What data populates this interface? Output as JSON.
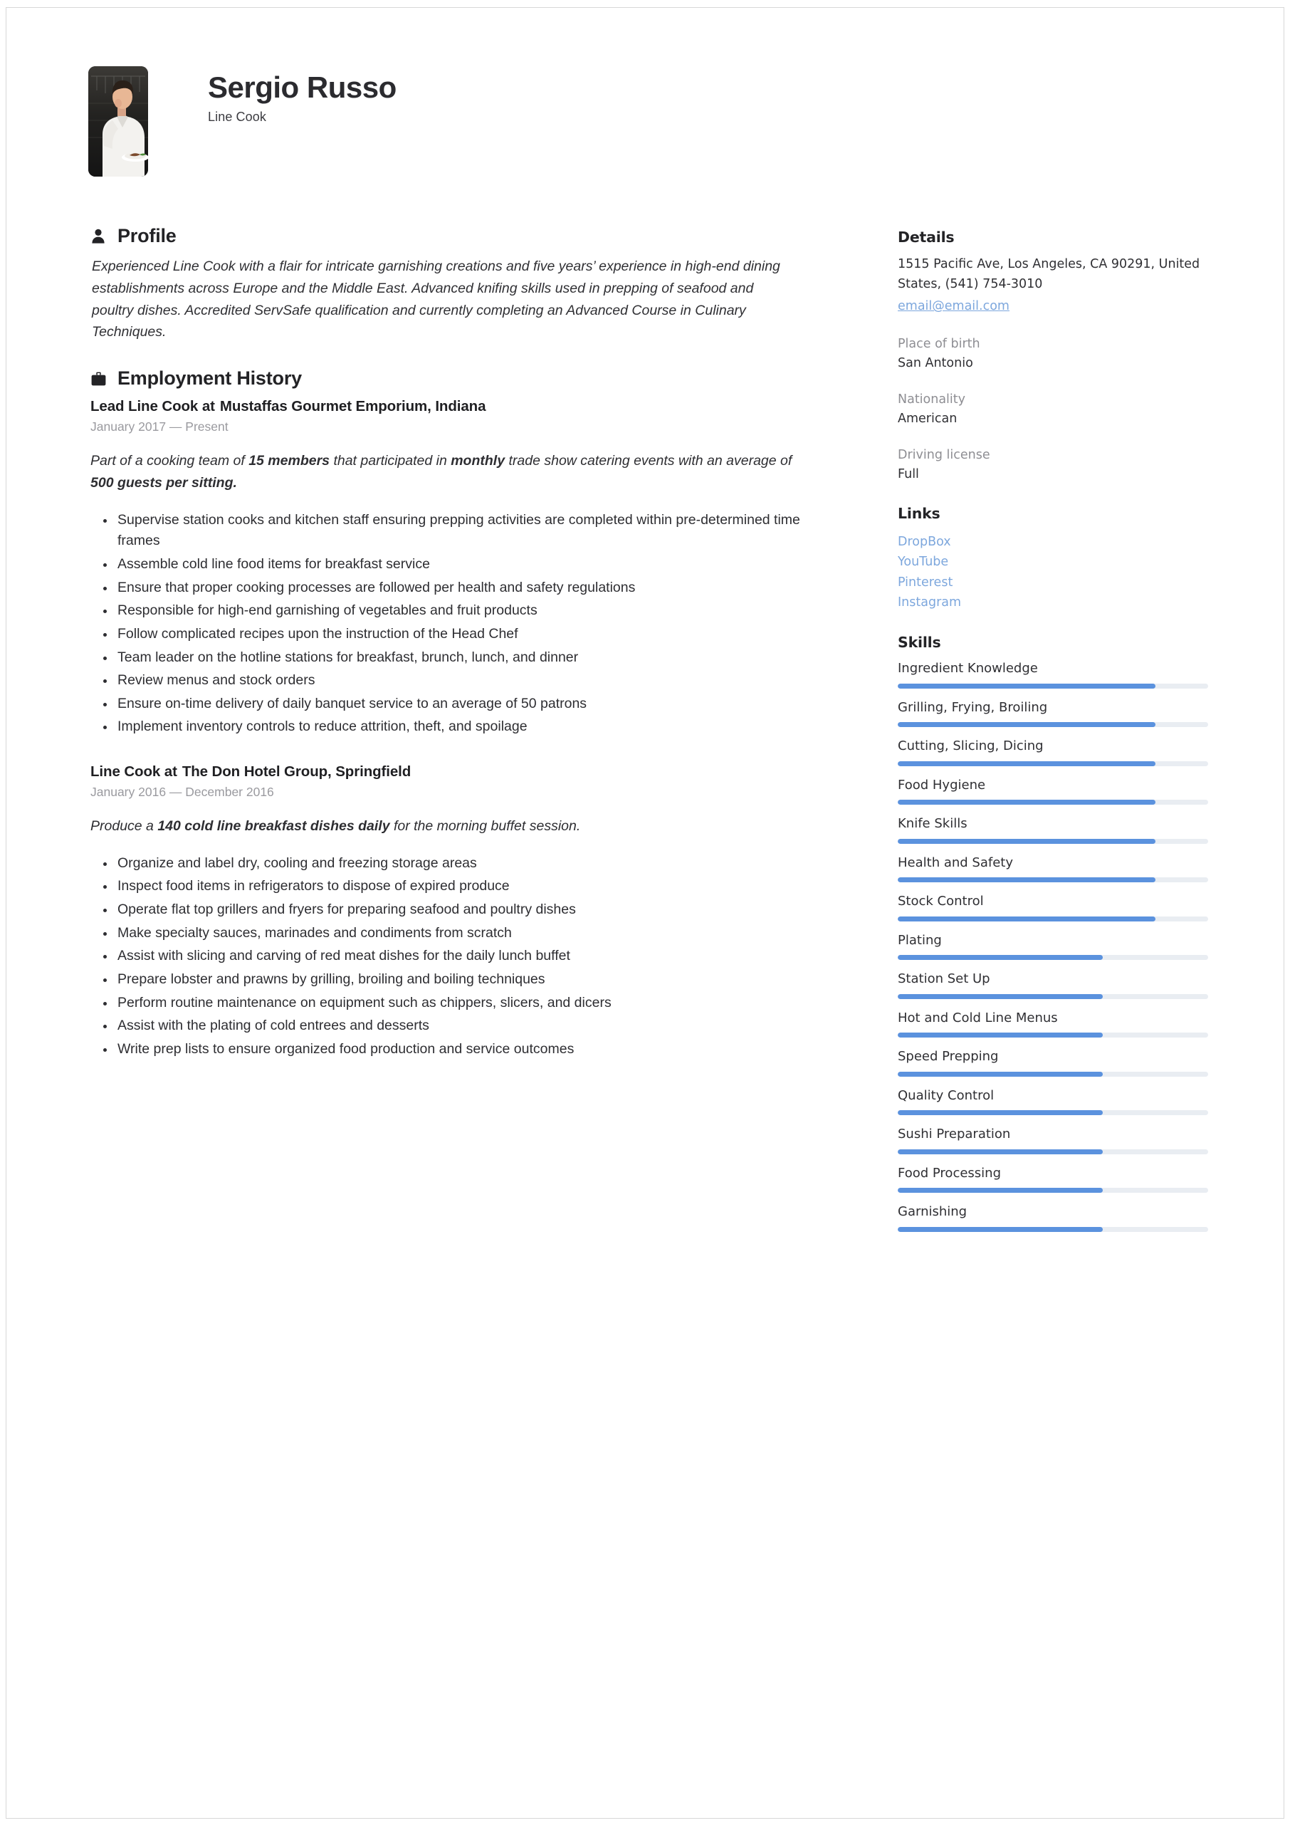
{
  "header": {
    "name": "Sergio Russo",
    "title": "Line Cook",
    "avatar_icon": "chef-photo"
  },
  "profile": {
    "icon": "person-icon",
    "heading": "Profile",
    "text": "Experienced Line Cook with a flair for intricate garnishing creations and five years’ experience in high-end dining establishments across Europe and the Middle East. Advanced knifing skills used in prepping of seafood and poultry dishes. Accredited ServSafe qualification and currently completing an Advanced Course in Culinary Techniques."
  },
  "employment": {
    "icon": "briefcase-icon",
    "heading": "Employment History",
    "jobs": [
      {
        "role": "Lead Line Cook at",
        "company": "Mustaffas Gourmet Emporium, Indiana",
        "dates": "January 2017 — Present",
        "summary_parts": [
          {
            "text": "Part of a cooking team of ",
            "bold": false
          },
          {
            "text": "15 members",
            "bold": true
          },
          {
            "text": " that participated in ",
            "bold": false
          },
          {
            "text": "monthly",
            "bold": true
          },
          {
            "text": " trade show catering events with an average of ",
            "bold": false
          },
          {
            "text": "500 guests per sitting.",
            "bold": true
          }
        ],
        "bullets": [
          "Supervise station cooks and kitchen staff ensuring prepping activities are completed within pre-determined time frames",
          "Assemble cold line food items for breakfast service",
          "Ensure that proper cooking processes are followed per health and safety regulations",
          "Responsible for high-end garnishing of vegetables and fruit products",
          "Follow complicated recipes upon the instruction of the Head Chef",
          "Team leader on the hotline stations for breakfast, brunch, lunch, and dinner",
          "Review menus and stock orders",
          "Ensure on-time delivery of daily banquet service to an average of 50 patrons",
          "Implement inventory controls to reduce attrition, theft, and spoilage"
        ]
      },
      {
        "role": "Line Cook at",
        "company": "The Don Hotel Group, Springfield",
        "dates": "January 2016 — December 2016",
        "summary_parts": [
          {
            "text": "Produce a ",
            "bold": false
          },
          {
            "text": "140 cold line breakfast dishes daily",
            "bold": true
          },
          {
            "text": " for the morning buffet session.",
            "bold": false
          }
        ],
        "bullets": [
          "Organize and label dry, cooling and freezing storage areas",
          "Inspect food items in refrigerators to dispose of expired produce",
          "Operate flat top grillers and fryers for preparing seafood and poultry dishes",
          "Make specialty sauces, marinades and condiments from scratch",
          "Assist with slicing and carving of red meat dishes for the daily lunch buffet",
          "Prepare lobster and prawns by grilling, broiling and boiling techniques",
          "Perform routine maintenance on equipment such as chippers, slicers, and dicers",
          "Assist with the plating of cold entrees and desserts",
          "Write prep lists to ensure organized food production and service outcomes"
        ]
      }
    ]
  },
  "details": {
    "heading": "Details",
    "address": "1515 Pacific Ave, Los Angeles, CA 90291, United States, (541) 754-3010",
    "email": "email@email.com",
    "fields": [
      {
        "label": "Place of birth",
        "value": "San Antonio"
      },
      {
        "label": "Nationality",
        "value": "American"
      },
      {
        "label": "Driving license",
        "value": "Full"
      }
    ]
  },
  "links": {
    "heading": "Links",
    "items": [
      "DropBox",
      "YouTube",
      "Pinterest",
      "Instagram"
    ]
  },
  "skills": {
    "heading": "Skills",
    "items": [
      {
        "name": "Ingredient Knowledge",
        "level": 83
      },
      {
        "name": "Grilling, Frying, Broiling",
        "level": 83
      },
      {
        "name": "Cutting, Slicing, Dicing",
        "level": 83
      },
      {
        "name": "Food Hygiene",
        "level": 83
      },
      {
        "name": "Knife Skills",
        "level": 83
      },
      {
        "name": "Health and Safety",
        "level": 83
      },
      {
        "name": "Stock Control",
        "level": 83
      },
      {
        "name": "Plating",
        "level": 66
      },
      {
        "name": "Station Set Up",
        "level": 66
      },
      {
        "name": "Hot and Cold Line Menus",
        "level": 66
      },
      {
        "name": "Speed Prepping",
        "level": 66
      },
      {
        "name": "Quality Control",
        "level": 66
      },
      {
        "name": "Sushi Preparation",
        "level": 66
      },
      {
        "name": "Food Processing",
        "level": 66
      },
      {
        "name": "Garnishing",
        "level": 66
      }
    ]
  },
  "colors": {
    "accent_blue": "#5b92de",
    "link_blue": "#7da7dd",
    "track_gray": "#e9edf2",
    "muted_gray": "#8e8e93",
    "text_dark": "#2f2f33"
  }
}
